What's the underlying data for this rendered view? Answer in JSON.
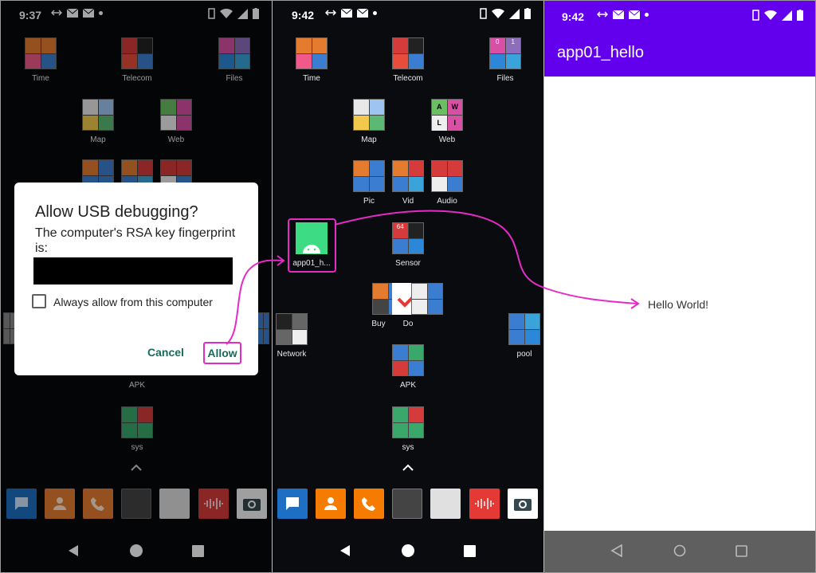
{
  "panel1": {
    "status_time": "9:37",
    "apps": [
      {
        "label": "Time"
      },
      {
        "label": "Telecom"
      },
      {
        "label": "Files"
      },
      {
        "label": "Map"
      },
      {
        "label": "Web"
      },
      {
        "label": "APK"
      },
      {
        "label": "sys"
      }
    ],
    "dialog": {
      "title": "Allow USB debugging?",
      "message": "The computer's RSA key fingerprint is:",
      "checkbox_label": "Always allow from this computer",
      "cancel_label": "Cancel",
      "allow_label": "Allow"
    }
  },
  "panel2": {
    "status_time": "9:42",
    "apps": [
      {
        "label": "Time"
      },
      {
        "label": "Telecom"
      },
      {
        "label": "Files"
      },
      {
        "label": "Map"
      },
      {
        "label": "Web"
      },
      {
        "label": "Pic"
      },
      {
        "label": "Vid"
      },
      {
        "label": "Audio"
      },
      {
        "label": "app01_h..."
      },
      {
        "label": "Sensor"
      },
      {
        "label": "Buy"
      },
      {
        "label": "Do"
      },
      {
        "label": "Network"
      },
      {
        "label": "pool"
      },
      {
        "label": "APK"
      },
      {
        "label": "sys"
      }
    ],
    "tile_text": {
      "files_0": "0",
      "files_1": "1",
      "web_a": "A",
      "web_w": "W",
      "web_l": "L",
      "web_i": "I",
      "sensor_64": "64"
    }
  },
  "panel3": {
    "status_time": "9:42",
    "app_title": "app01_hello",
    "content_text": "Hello World!"
  },
  "colors": {
    "accent_magenta": "#e52bc5",
    "app_bar_purple": "#6200ee",
    "dialog_button_teal": "#1a6a5a"
  }
}
